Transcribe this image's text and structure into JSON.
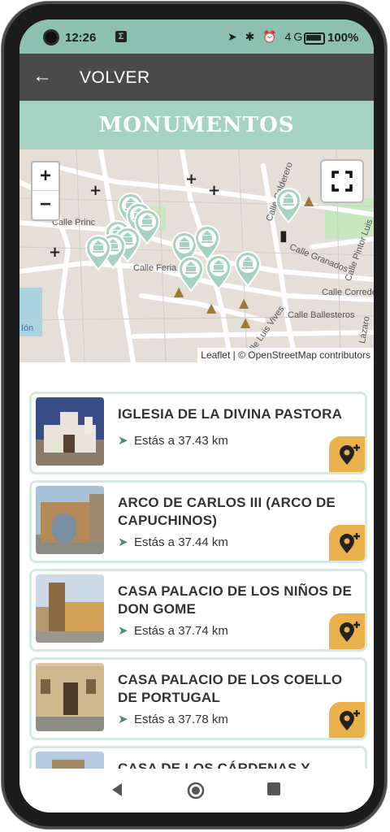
{
  "status": {
    "time": "12:26",
    "app_badge": "Σ",
    "icons": "➤ ✱ ⏰ 4G",
    "battery": "100%"
  },
  "appbar": {
    "back_icon": "arrow-left-icon",
    "title": "VOLVER"
  },
  "banner": {
    "title": "MONUMENTOS"
  },
  "map": {
    "zoom_in": "+",
    "zoom_out": "−",
    "attribution": "Leaflet | © OpenStreetMap contributors",
    "labels": [
      "Calle Princ",
      "Calle Feria",
      "Calle Calderero",
      "Calle Granados",
      "Calle Pintor Luis",
      "Calle Corredera",
      "Calle Ballesteros",
      "Calle Luis Vives",
      "Lázaro",
      "Ión"
    ],
    "marker_color": "#a6d2c4"
  },
  "monuments": [
    {
      "name": "IGLESIA DE LA DIVINA PASTORA",
      "distance": "Estás a 37.43 km"
    },
    {
      "name": "ARCO DE CARLOS III (ARCO DE CAPUCHINOS)",
      "distance": "Estás a 37.44 km"
    },
    {
      "name": "CASA PALACIO DE LOS NIÑOS DE DON GOME",
      "distance": "Estás a 37.74 km"
    },
    {
      "name": "CASA PALACIO DE LOS COELLO DE PORTUGAL",
      "distance": "Estás a 37.78 km"
    },
    {
      "name": "CASA DE LOS CÁRDENAS Y VALDIVIA",
      "distance": ""
    }
  ],
  "colors": {
    "accent": "#a6d2c4",
    "button": "#eab04a",
    "appbar": "#4a4a4a"
  }
}
